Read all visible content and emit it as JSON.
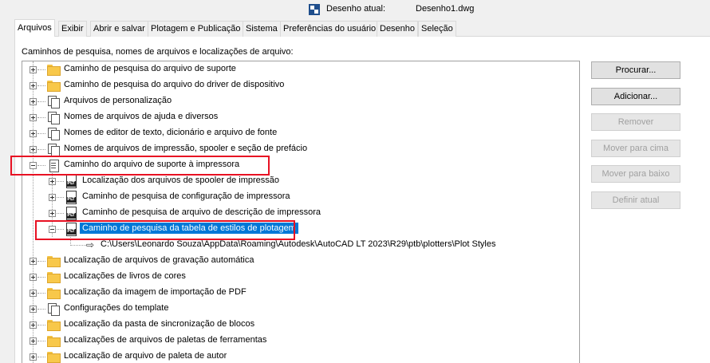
{
  "header": {
    "current_drawing_label": "Desenho atual:",
    "current_drawing_value": "Desenho1.dwg"
  },
  "tabs": [
    {
      "label": "Arquivos",
      "active": true
    },
    {
      "label": "Exibir"
    },
    {
      "label": "Abrir e salvar"
    },
    {
      "label": "Plotagem e Publicação"
    },
    {
      "label": "Sistema"
    },
    {
      "label": "Preferências do usuário"
    },
    {
      "label": "Desenho"
    },
    {
      "label": "Seleção"
    }
  ],
  "panel": {
    "caption": "Caminhos de pesquisa, nomes de arquivos e localizações de arquivo:"
  },
  "tree": {
    "items": [
      {
        "label": "Caminho de pesquisa do arquivo de suporte",
        "icon": "folder-icon"
      },
      {
        "label": "Caminho de pesquisa do arquivo do driver de dispositivo",
        "icon": "folder-icon"
      },
      {
        "label": "Arquivos de personalização",
        "icon": "files-icon"
      },
      {
        "label": "Nomes de arquivos de ajuda e diversos",
        "icon": "files-icon"
      },
      {
        "label": "Nomes de editor de texto, dicionário e arquivo de fonte",
        "icon": "files-icon"
      },
      {
        "label": "Nomes de arquivos de impressão, spooler e seção de prefácio",
        "icon": "files-icon"
      },
      {
        "label": "Caminho do arquivo de suporte à impressora",
        "icon": "doc-icon",
        "expanded": true
      },
      {
        "label": "Localização dos arquivos de spooler de impressão",
        "icon": "plt-file-icon"
      },
      {
        "label": "Caminho de pesquisa de configuração de impressora",
        "icon": "plt-file-icon"
      },
      {
        "label": "Caminho de pesquisa de arquivo de descrição de impressora",
        "icon": "plt-file-icon"
      },
      {
        "label": "Caminho de pesquisa da tabela de estilos de plotagem",
        "icon": "plt-file-icon",
        "selected": true,
        "expanded": true
      },
      {
        "label": "C:\\Users\\Leonardo Souza\\AppData\\Roaming\\Autodesk\\AutoCAD LT 2023\\R29\\ptb\\plotters\\Plot Styles",
        "icon": "arrow-right-icon"
      },
      {
        "label": "Localização de arquivos de gravação automática",
        "icon": "folder-icon"
      },
      {
        "label": "Localizações de livros de cores",
        "icon": "folder-icon"
      },
      {
        "label": "Localização da imagem de importação de PDF",
        "icon": "folder-icon"
      },
      {
        "label": "Configurações do template",
        "icon": "files-icon"
      },
      {
        "label": "Localização da pasta de sincronização de blocos",
        "icon": "folder-icon"
      },
      {
        "label": "Localizações de arquivos de paletas de ferramentas",
        "icon": "folder-icon"
      },
      {
        "label": "Localização de arquivo de paleta de autor",
        "icon": "folder-icon"
      }
    ]
  },
  "buttons": {
    "browse": "Procurar...",
    "add": "Adicionar...",
    "remove": "Remover",
    "move_up": "Mover para cima",
    "move_down": "Mover para baixo",
    "set_current": "Definir atual"
  },
  "colors": {
    "selection": "#0078d7",
    "highlight_box": "#e81123"
  }
}
